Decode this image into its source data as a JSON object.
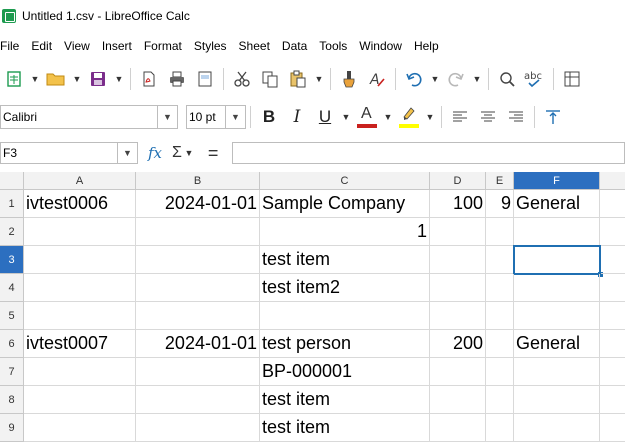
{
  "window": {
    "title": "Untitled 1.csv - LibreOffice Calc"
  },
  "menu": [
    "File",
    "Edit",
    "View",
    "Insert",
    "Format",
    "Styles",
    "Sheet",
    "Data",
    "Tools",
    "Window",
    "Help"
  ],
  "toolbar": {
    "font_name": "Calibri",
    "font_size": "10 pt",
    "bold": "B",
    "italic": "I",
    "underline": "U",
    "font_color_letter": "A",
    "spelling_label": "abc",
    "font_color": "#c9211e",
    "highlight_color": "#ffff00"
  },
  "formula_bar": {
    "cell_ref": "F3",
    "fx": "fx",
    "sigma": "Σ",
    "equals": "=",
    "formula": ""
  },
  "sheet": {
    "columns": [
      "A",
      "B",
      "C",
      "D",
      "E",
      "F"
    ],
    "rows": [
      "1",
      "2",
      "3",
      "4",
      "5",
      "6",
      "7",
      "8",
      "9"
    ],
    "cells": {
      "r1": {
        "A": "ivtest0006",
        "B": "2024-01-01",
        "C": "Sample Company",
        "D": "100",
        "E": "9",
        "F": "General"
      },
      "r2": {
        "C": "1"
      },
      "r3": {
        "C": "test item"
      },
      "r4": {
        "C": "test item2"
      },
      "r6": {
        "A": "ivtest0007",
        "B": "2024-01-01",
        "C": "test person",
        "D": "200",
        "F": "General"
      },
      "r7": {
        "C": "BP-000001"
      },
      "r8": {
        "C": "test item"
      },
      "r9": {
        "C": "test item"
      }
    },
    "active_cell": "F3"
  }
}
